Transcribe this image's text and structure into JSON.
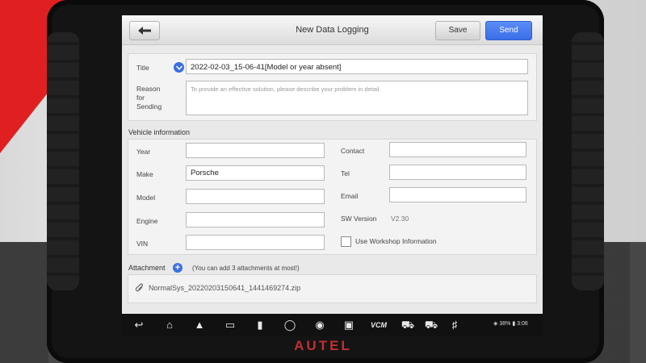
{
  "header": {
    "title": "New Data Logging",
    "save_label": "Save",
    "send_label": "Send"
  },
  "form": {
    "title_label": "Title",
    "title_value": "2022-02-03_15-06-41[Model or year absent]",
    "reason_label_1": "Reason",
    "reason_label_2": "for",
    "reason_label_3": "Sending",
    "reason_placeholder": "To provide an effective solution, please describe your problem in detail."
  },
  "vehicle": {
    "section_label": "Vehicle information",
    "year_label": "Year",
    "year_value": "",
    "make_label": "Make",
    "make_value": "Porsche",
    "model_label": "Model",
    "model_value": "",
    "engine_label": "Engine",
    "engine_value": "",
    "vin_label": "VIN",
    "vin_value": "",
    "contact_label": "Contact",
    "contact_value": "",
    "tel_label": "Tel",
    "tel_value": "",
    "email_label": "Email",
    "email_value": "",
    "sw_version_label": "SW Version",
    "sw_version_value": "V2.30",
    "workshop_label": "Use Workshop Information"
  },
  "attachment": {
    "label": "Attachment",
    "hint": "(You can add 3 attachments at most!)",
    "file_name": "NormalSys_20220203150641_1441469274.zip"
  },
  "statusbar": {
    "battery": "38%",
    "time": "3:06"
  },
  "navbar": {
    "vcm_label": "VCM"
  },
  "device": {
    "brand": "AUTEL"
  },
  "colors": {
    "accent": "#3b6fe0",
    "brand_red": "#c23030"
  }
}
